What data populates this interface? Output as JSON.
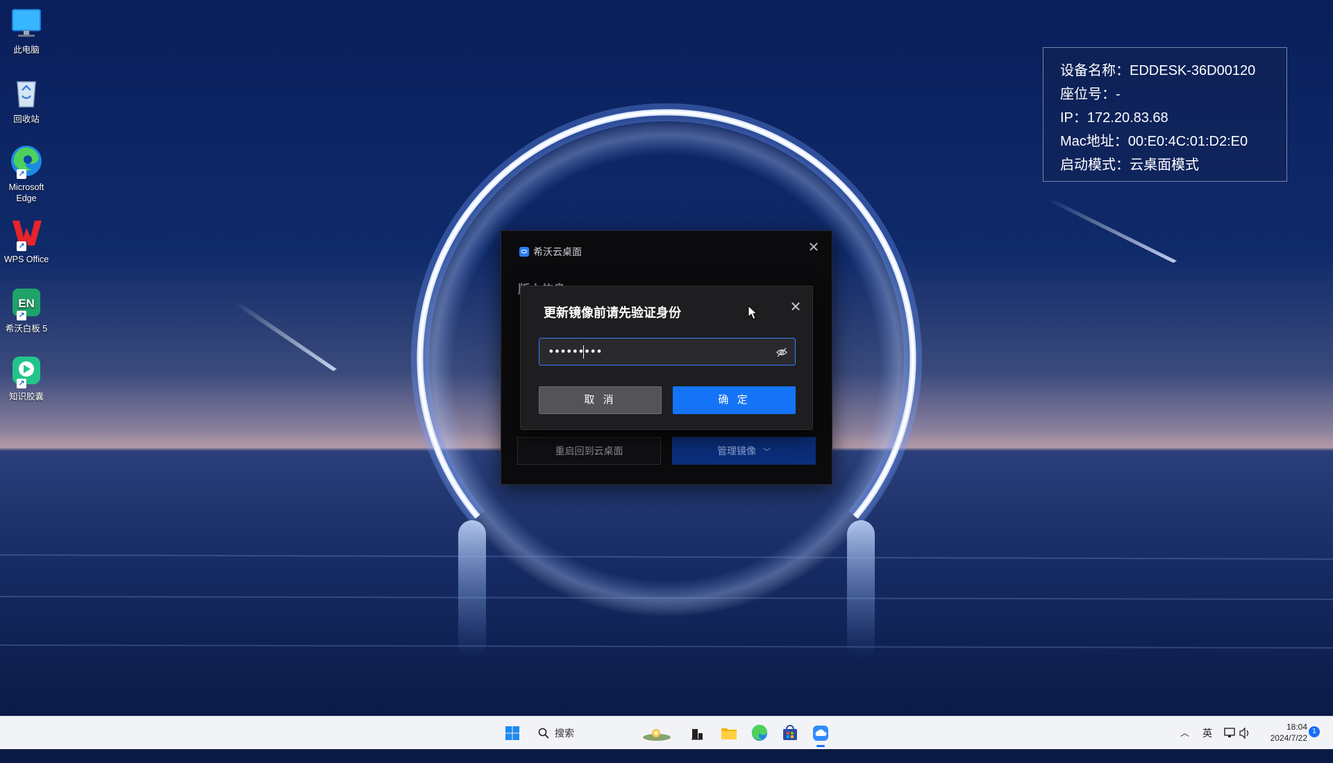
{
  "desktop": {
    "icons": [
      {
        "label": "此电脑"
      },
      {
        "label": "回收站"
      },
      {
        "label": "Microsoft Edge"
      },
      {
        "label": "WPS Office"
      },
      {
        "label": "希沃白板 5"
      },
      {
        "label": "知识胶囊"
      }
    ],
    "en_badge": "EN"
  },
  "info_panel": {
    "device_name": "设备名称：EDDESK-36D00120",
    "seat": "座位号：-",
    "ip": "IP：172.20.83.68",
    "mac": "Mac地址：00:E0:4C:01:D2:E0",
    "boot_mode": "启动模式：云桌面模式"
  },
  "app_window": {
    "title": "希沃云桌面",
    "section_label": "版本信息",
    "restart_label": "重启回到云桌面",
    "manage_label": "管理镜像"
  },
  "auth_dialog": {
    "title": "更新镜像前请先验证身份",
    "password_value": "•••••••••",
    "cancel_label": "取 消",
    "confirm_label": "确 定"
  },
  "taskbar": {
    "search_label": "搜索",
    "ime": "英",
    "time": "18:04",
    "date": "2024/7/22",
    "notification_count": "1"
  },
  "colors": {
    "accent": "#1473f7",
    "taskbar_bg": "#f2f3f7"
  }
}
